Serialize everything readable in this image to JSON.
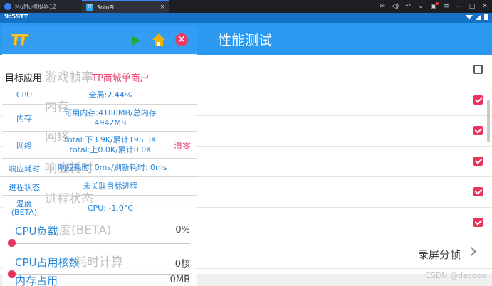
{
  "host": {
    "tabs": [
      {
        "label": "MuMu模拟器12",
        "active": false
      },
      {
        "label": "SoloPi",
        "active": true
      }
    ],
    "close_glyph": "×",
    "icons": [
      "mail-icon",
      "volume-icon",
      "back-icon",
      "dropdown-icon",
      "message-icon",
      "menu-icon",
      "minimize-icon",
      "maximize-icon",
      "close-icon"
    ]
  },
  "status": {
    "time": "9:59",
    "app_badge": "TT"
  },
  "app": {
    "title": "性能测试",
    "rows": [
      {
        "label": "游戏帧率",
        "checked": false
      },
      {
        "label": "内存",
        "checked": true
      },
      {
        "label": "网络",
        "checked": true
      },
      {
        "label": "响应耗时",
        "checked": true
      },
      {
        "label": "进程状态",
        "checked": true
      },
      {
        "label": "温度",
        "checked": true
      }
    ],
    "record_label": "录屏分帧"
  },
  "floating": {
    "logo": "TT",
    "target_label": "目标应用",
    "target_value": "TP商城单商户",
    "metrics": [
      {
        "label": "CPU",
        "value_lines": [
          "全局:2.44%"
        ]
      },
      {
        "label": "内存",
        "value_lines": [
          "可用内存:4180MB/总内存",
          "4942MB"
        ]
      },
      {
        "label": "网络",
        "value_lines": [
          "total:下3.9K/累计195.3K",
          "total:上0.0K/累计0.0K"
        ],
        "action": "清零"
      },
      {
        "label": "响应耗时",
        "value_lines": [
          "响应耗时: 0ms/刷新耗时: 0ms"
        ]
      },
      {
        "label": "进程状态",
        "value_lines": [
          "未关联目标进程"
        ]
      },
      {
        "label": "温度\n(BETA)",
        "label_lines": [
          "温度",
          "(BETA)"
        ],
        "value_lines": [
          "CPU: -1.0°C"
        ]
      }
    ],
    "ghost": {
      "game": "游戏帧率",
      "memory": "内存",
      "network": "网络",
      "response": "响应耗时",
      "process": "进程状态",
      "cpu_load_beta": "度(BETA)",
      "time_calc": "耗时计算"
    },
    "seekbars": [
      {
        "label": "CPU负载",
        "value": "0%",
        "level": 0
      },
      {
        "label": "CPU占用核数",
        "value": "0核",
        "level": 0
      },
      {
        "label": "内存占用",
        "value": "0MB",
        "level": 0
      }
    ]
  },
  "watermark": "CSDN @dacooo",
  "colors": {
    "app_bar": "#2a9af0",
    "status_bar": "#1572c6",
    "accent_pink": "#e8345c",
    "metric_blue": "#2a86d8"
  }
}
